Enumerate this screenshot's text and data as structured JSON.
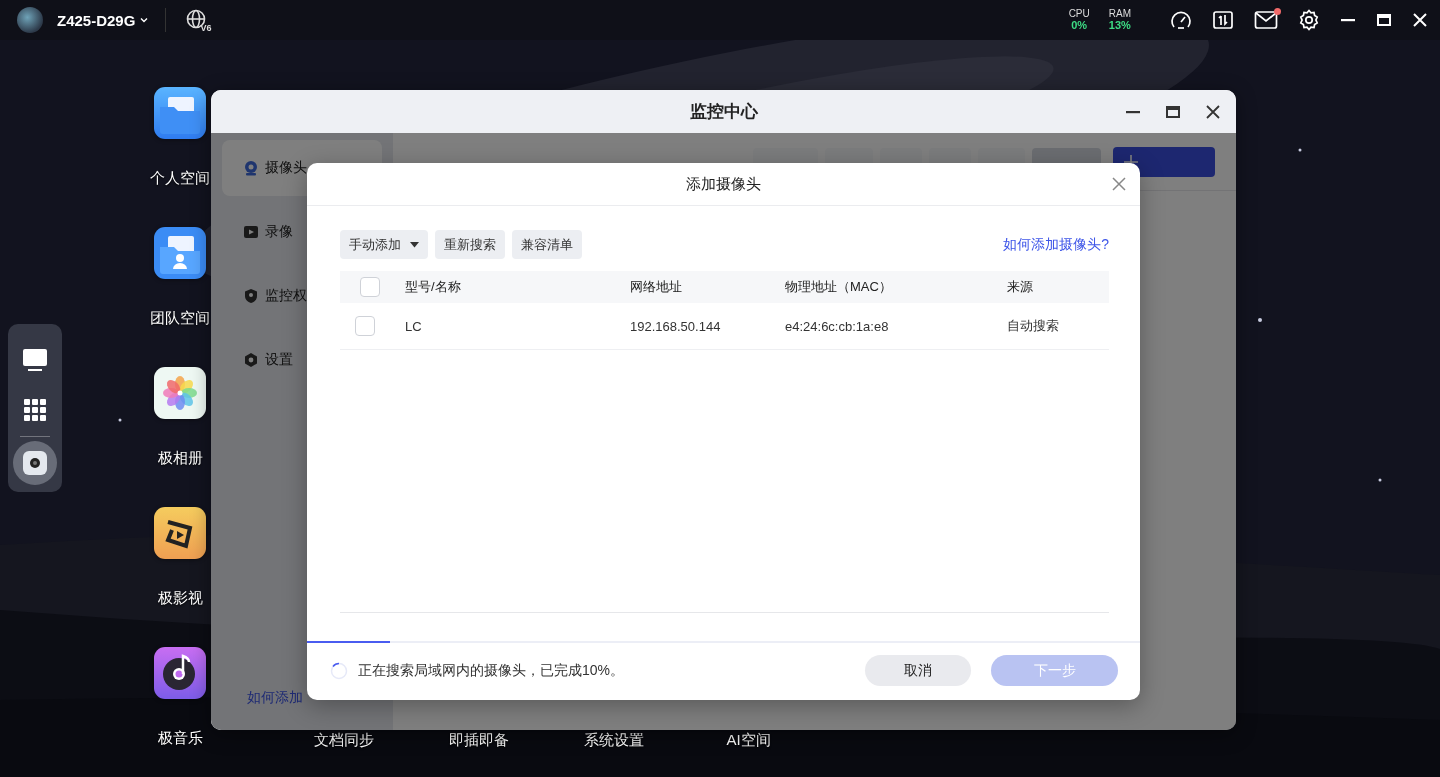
{
  "top_bar": {
    "device_name": "Z425-D29G",
    "network_badge": "V6",
    "stats": [
      {
        "label": "CPU",
        "value": "0%"
      },
      {
        "label": "RAM",
        "value": "13%"
      }
    ],
    "mail_unread": true
  },
  "dock": {
    "items": [
      {
        "kind": "screen",
        "selected": false
      },
      {
        "kind": "apps",
        "selected": false
      },
      {
        "kind": "camera",
        "selected": true
      }
    ]
  },
  "desktop_icons": [
    {
      "label": "个人空间",
      "kind": "folder"
    },
    {
      "label": "团队空间",
      "kind": "team"
    },
    {
      "label": "极相册",
      "kind": "photos"
    },
    {
      "label": "极影视",
      "kind": "video"
    },
    {
      "label": "极音乐",
      "kind": "music"
    }
  ],
  "desktop_labels_behind_window": [
    "文档同步",
    "即插即备",
    "系统设置",
    "AI空间"
  ],
  "window": {
    "title": "监控中心",
    "sidebar": {
      "items": [
        {
          "label": "摄像头",
          "kind": "camera",
          "selected": true
        },
        {
          "label": "录像",
          "kind": "recording",
          "selected": false
        },
        {
          "label": "监控权",
          "kind": "permission",
          "selected": false
        },
        {
          "label": "设置",
          "kind": "settings",
          "selected": false
        }
      ],
      "help_link": "如何添加"
    },
    "toolbar": {
      "buttons": [
        {
          "kind": "plain",
          "disabled": true
        },
        {
          "kind": "plain",
          "disabled": true
        },
        {
          "kind": "plain",
          "disabled": true
        },
        {
          "kind": "plain",
          "disabled": true
        },
        {
          "kind": "plain",
          "disabled": true
        },
        {
          "kind": "plain",
          "disabled": false
        },
        {
          "kind": "primary",
          "disabled": false
        }
      ]
    }
  },
  "dialog": {
    "title": "添加摄像头",
    "toolbar": {
      "buttons": [
        {
          "label": "手动添加",
          "kind": "dropdown"
        },
        {
          "label": "重新搜索",
          "kind": "plain"
        },
        {
          "label": "兼容清单",
          "kind": "plain"
        }
      ],
      "help_link": "如何添加摄像头?"
    },
    "table": {
      "columns": [
        "型号/名称",
        "网络地址",
        "物理地址（MAC）",
        "来源"
      ],
      "all_checked": false,
      "rows": [
        {
          "checked": false,
          "cells": [
            "LC",
            "192.168.50.144",
            "e4:24:6c:cb:1a:e8",
            "自动搜索"
          ]
        }
      ]
    },
    "progress": {
      "level": 0.1,
      "message": "正在搜索局域网内的摄像头，已完成10%。"
    },
    "buttons": [
      {
        "label": "取消",
        "disabled": false
      },
      {
        "label": "下一步",
        "disabled": true
      }
    ]
  }
}
